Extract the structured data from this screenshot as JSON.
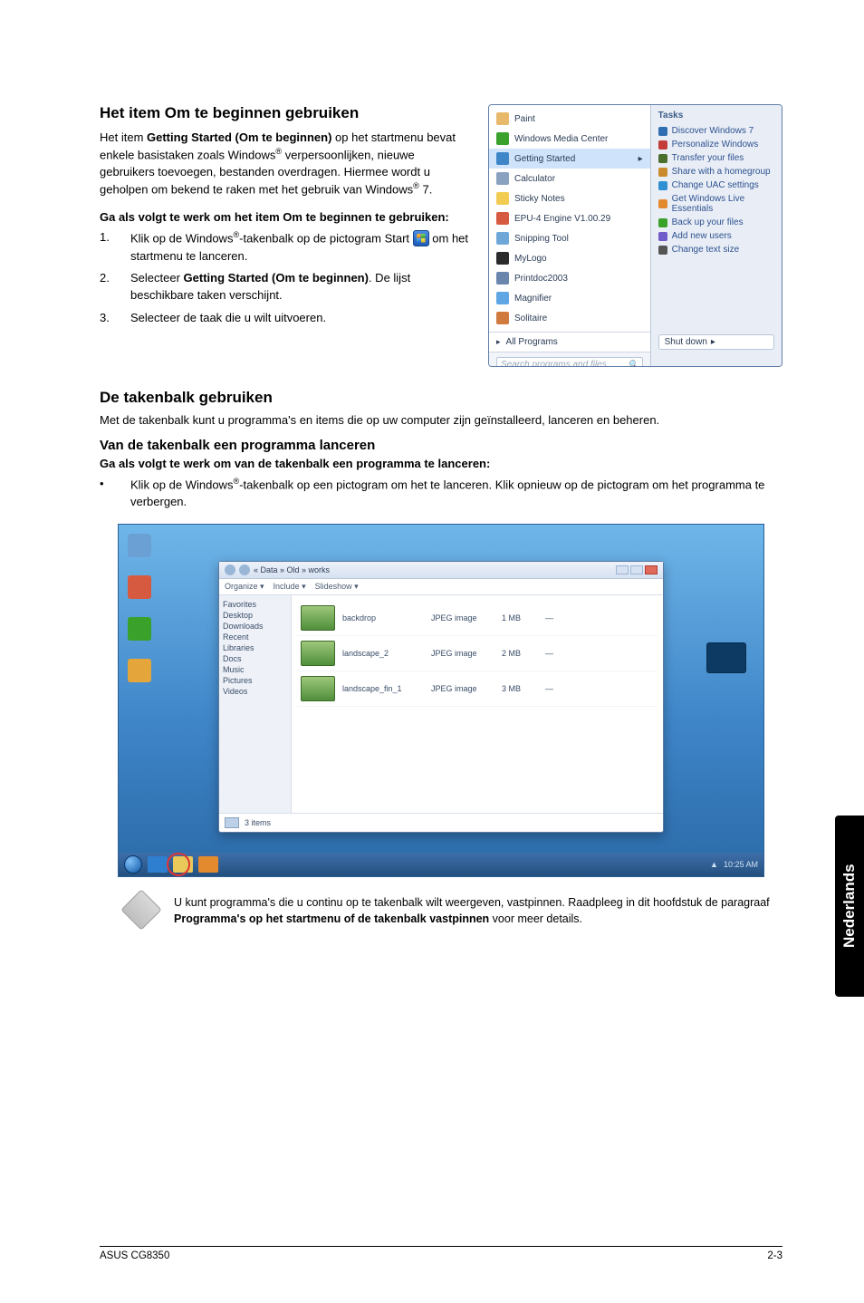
{
  "doc": {
    "heading1": "Het item Om te beginnen gebruiken",
    "intro_html": "Het item **Getting Started (Om te beginnen)** op het startmenu bevat enkele basistaken zoals Windows® verpersoonlijken, nieuwe gebruikers toevoegen, bestanden overdragen. Hiermee wordt u geholpen om bekend te raken met het gebruik van Windows® 7.",
    "intro_bold": "Getting Started (Om te beginnen)",
    "intro_before": "Het item ",
    "intro_after": " op het startmenu bevat enkele basistaken zoals Windows",
    "intro_tail": " verpersoonlijken, nieuwe gebruikers toevoegen, bestanden overdragen. Hiermee wordt u geholpen om bekend te raken met het gebruik van Windows",
    "intro_end": " 7.",
    "subhead1": "Ga als volgt te werk om het item Om te beginnen te gebruiken:",
    "steps": [
      {
        "num": "1.",
        "before": "Klik op de Windows",
        "mid": "-takenbalk op de pictogram Start ",
        "after": " om het startmenu te lanceren."
      },
      {
        "num": "2.",
        "before": "Selecteer ",
        "bold": "Getting Started (Om te beginnen)",
        "after": ". De lijst beschikbare taken verschijnt."
      },
      {
        "num": "3.",
        "text": "Selecteer de taak die u wilt uitvoeren."
      }
    ],
    "heading2": "De takenbalk gebruiken",
    "para2": "Met de takenbalk kunt u programma's en items die op uw computer zijn geïnstalleerd, lanceren en beheren.",
    "heading3": "Van de takenbalk een programma lanceren",
    "subhead2": "Ga als volgt te werk om van de takenbalk een programma te lanceren:",
    "bullet_before": "Klik op de Windows",
    "bullet_after": "-takenbalk op een pictogram om het te lanceren. Klik opnieuw op de pictogram om het programma te verbergen.",
    "note_before": "U kunt programma's die u continu op te takenbalk wilt weergeven, vastpinnen. Raadpleeg in dit hoofdstuk de paragraaf ",
    "note_bold": "Programma's op het startmenu of de takenbalk vastpinnen",
    "note_after": " voor meer details.",
    "side_tab": "Nederlands",
    "footer_left": "ASUS CG8350",
    "footer_right": "2-3"
  },
  "startmenu": {
    "items": [
      {
        "label": "Paint",
        "color": "#e8b96b"
      },
      {
        "label": "Windows Media Center",
        "color": "#3aa12b"
      },
      {
        "label": "Getting Started",
        "color": "#3f86c9",
        "hl": true,
        "arrow": true
      },
      {
        "label": "Calculator",
        "color": "#8aa2bf"
      },
      {
        "label": "Sticky Notes",
        "color": "#f2cc52"
      },
      {
        "label": "EPU-4 Engine V1.00.29",
        "color": "#d65a3f"
      },
      {
        "label": "Snipping Tool",
        "color": "#6fa8d8"
      },
      {
        "label": "MyLogo",
        "color": "#2b2b2b"
      },
      {
        "label": "Printdoc2003",
        "color": "#6b86ac"
      },
      {
        "label": "Magnifier",
        "color": "#5ea7e4"
      },
      {
        "label": "Solitaire",
        "color": "#d17a3e"
      }
    ],
    "all_programs": "All Programs",
    "search_placeholder": "Search programs and files",
    "tasks_head": "Tasks",
    "tasks": [
      {
        "label": "Discover Windows 7",
        "color": "#2f6fb1"
      },
      {
        "label": "Personalize Windows",
        "color": "#c33c3a"
      },
      {
        "label": "Transfer your files",
        "color": "#4a6f2e"
      },
      {
        "label": "Share with a homegroup",
        "color": "#c98b2d"
      },
      {
        "label": "Change UAC settings",
        "color": "#2f8fd1"
      },
      {
        "label": "Get Windows Live Essentials",
        "color": "#e48a2e"
      },
      {
        "label": "Back up your files",
        "color": "#3aa12b"
      },
      {
        "label": "Add new users",
        "color": "#6f5bc9"
      },
      {
        "label": "Change text size",
        "color": "#555"
      }
    ],
    "shutdown": "Shut down"
  },
  "desktop": {
    "icons": [
      {
        "label": "",
        "color": "#6fb6e9"
      },
      {
        "label": "",
        "color": "#d65a3f"
      },
      {
        "label": "",
        "color": "#3aa12b"
      },
      {
        "label": "",
        "color": "#e4a63a"
      }
    ],
    "win_path": "« Data » Old » works",
    "win_menu": [
      "Organize ▾",
      "Include ▾",
      "Slideshow ▾"
    ],
    "side_items": [
      "Favorites",
      "Desktop",
      "Downloads",
      "Recent",
      "Libraries",
      "Docs",
      "Music",
      "Pictures",
      "Videos"
    ],
    "rows": [
      {
        "name": "backdrop",
        "type": "JPEG image",
        "size": "1 MB",
        "tags": "—"
      },
      {
        "name": "landscape_2",
        "type": "JPEG image",
        "size": "2 MB",
        "tags": "—"
      },
      {
        "name": "landscape_fin_1",
        "type": "JPEG image",
        "size": "3 MB",
        "tags": "—"
      }
    ],
    "footer_count": "3 items",
    "tray_time": "10:25 AM"
  }
}
